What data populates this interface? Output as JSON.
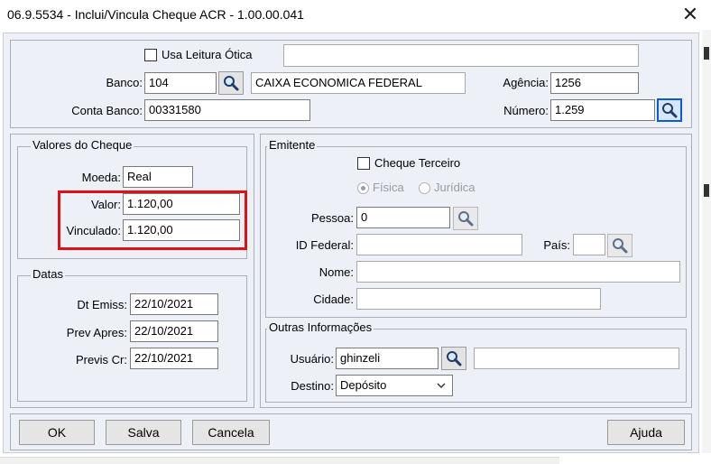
{
  "window": {
    "title": "06.9.5534 - Inclui/Vincula Cheque ACR - 1.00.00.041",
    "close_glyph": "✕"
  },
  "top": {
    "usa_leitura_otica_label": "Usa Leitura Ótica",
    "usa_leitura_otica_checked": false,
    "leitura_value": "",
    "banco_label": "Banco:",
    "banco_value": "104",
    "banco_name": "CAIXA ECONOMICA FEDERAL",
    "agencia_label": "Agência:",
    "agencia_value": "1256",
    "conta_label": "Conta Banco:",
    "conta_value": "00331580",
    "numero_label": "Número:",
    "numero_value": "1.259"
  },
  "valores": {
    "legend": "Valores do Cheque",
    "moeda_label": "Moeda:",
    "moeda_value": "Real",
    "valor_label": "Valor:",
    "valor_value": "1.120,00",
    "vinculado_label": "Vinculado:",
    "vinculado_value": "1.120,00",
    "highlight_color": "#e01111"
  },
  "datas": {
    "legend": "Datas",
    "dt_emiss_label": "Dt Emiss:",
    "dt_emiss_value": "22/10/2021",
    "prev_apres_label": "Prev Apres:",
    "prev_apres_value": "22/10/2021",
    "previs_cr_label": "Previs Cr:",
    "previs_cr_value": "22/10/2021"
  },
  "emitente": {
    "legend": "Emitente",
    "cheque_terceiro_label": "Cheque Terceiro",
    "cheque_terceiro_checked": false,
    "fisica_label": "Física",
    "juridica_label": "Jurídica",
    "pessoa_selected": "Física",
    "pessoa_label": "Pessoa:",
    "pessoa_value": "0",
    "id_federal_label": "ID Federal:",
    "id_federal_value": "",
    "pais_label": "País:",
    "pais_value": "",
    "nome_label": "Nome:",
    "nome_value": "",
    "cidade_label": "Cidade:",
    "cidade_value": ""
  },
  "outras": {
    "legend": "Outras Informações",
    "usuario_label": "Usuário:",
    "usuario_value": "ghinzeli",
    "usuario_extra_value": "",
    "destino_label": "Destino:",
    "destino_value": "Depósito"
  },
  "buttons": {
    "ok": "OK",
    "salva": "Salva",
    "cancela": "Cancela",
    "ajuda": "Ajuda"
  },
  "icons": {
    "search": "magnifier-icon",
    "close": "close-icon",
    "chevron": "chevron-down-icon"
  }
}
